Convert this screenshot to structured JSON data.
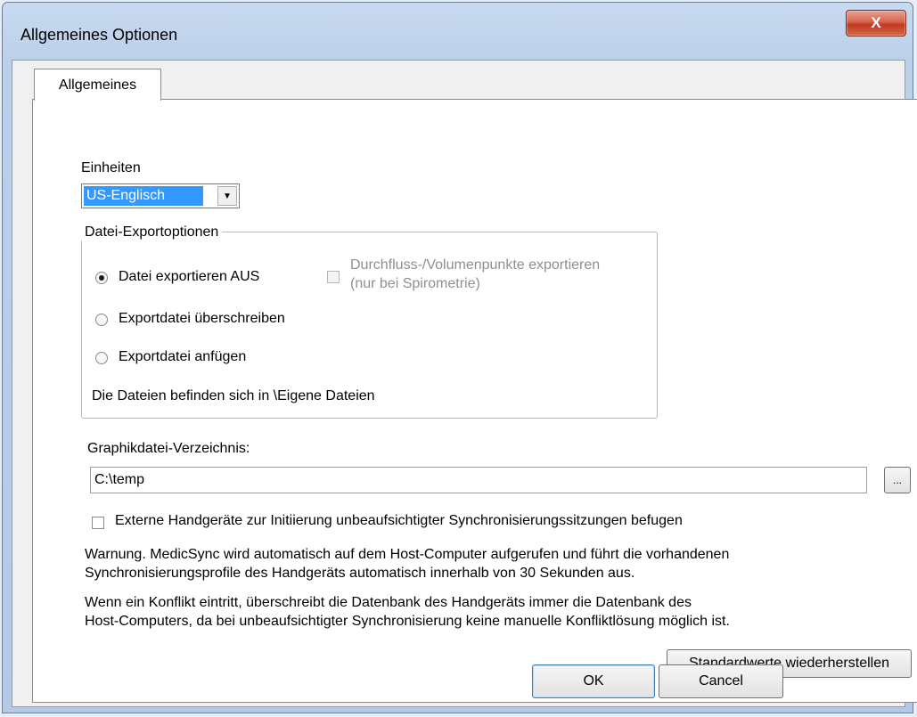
{
  "window": {
    "title": "Allgemeines Optionen",
    "close_glyph": "X"
  },
  "tabs": [
    {
      "label": "Allgemeines",
      "active": true
    }
  ],
  "units": {
    "label": "Einheiten",
    "selected": "US-Englisch"
  },
  "export": {
    "group_title": "Datei-Exportoptionen",
    "options": [
      {
        "label": "Datei exportieren AUS",
        "checked": true
      },
      {
        "label": "Exportdatei überschreiben",
        "checked": false
      },
      {
        "label": "Exportdatei anfügen",
        "checked": false
      }
    ],
    "flow_volume": {
      "line1": "Durchfluss-/Volumenpunkte exportieren",
      "line2": "(nur bei Spirometrie)",
      "checked": false,
      "enabled": false
    },
    "location_note": "Die Dateien befinden sich in \\Eigene Dateien"
  },
  "graphics": {
    "label": "Graphikdatei-Verzeichnis:",
    "value": "C:\\temp",
    "browse_label": "..."
  },
  "sync": {
    "checkbox_label": "Externe Handgeräte zur Initiierung unbeaufsichtigter Synchronisierungssitzungen befugen",
    "checked": false,
    "warning_line1": "Warnung.  MedicSync wird automatisch auf dem Host-Computer aufgerufen und führt die vorhandenen",
    "warning_line2": "Synchronisierungsprofile des Handgeräts automatisch innerhalb von 30 Sekunden aus.",
    "conflict_line1": "Wenn ein Konflikt eintritt, überschreibt die Datenbank des Handgeräts immer die Datenbank des",
    "conflict_line2": "Host-Computers, da bei unbeaufsichtigter Synchronisierung keine manuelle Konfliktlösung möglich ist."
  },
  "buttons": {
    "restore_defaults": "Standardwerte wiederherstellen",
    "ok": "OK",
    "cancel": "Cancel"
  }
}
